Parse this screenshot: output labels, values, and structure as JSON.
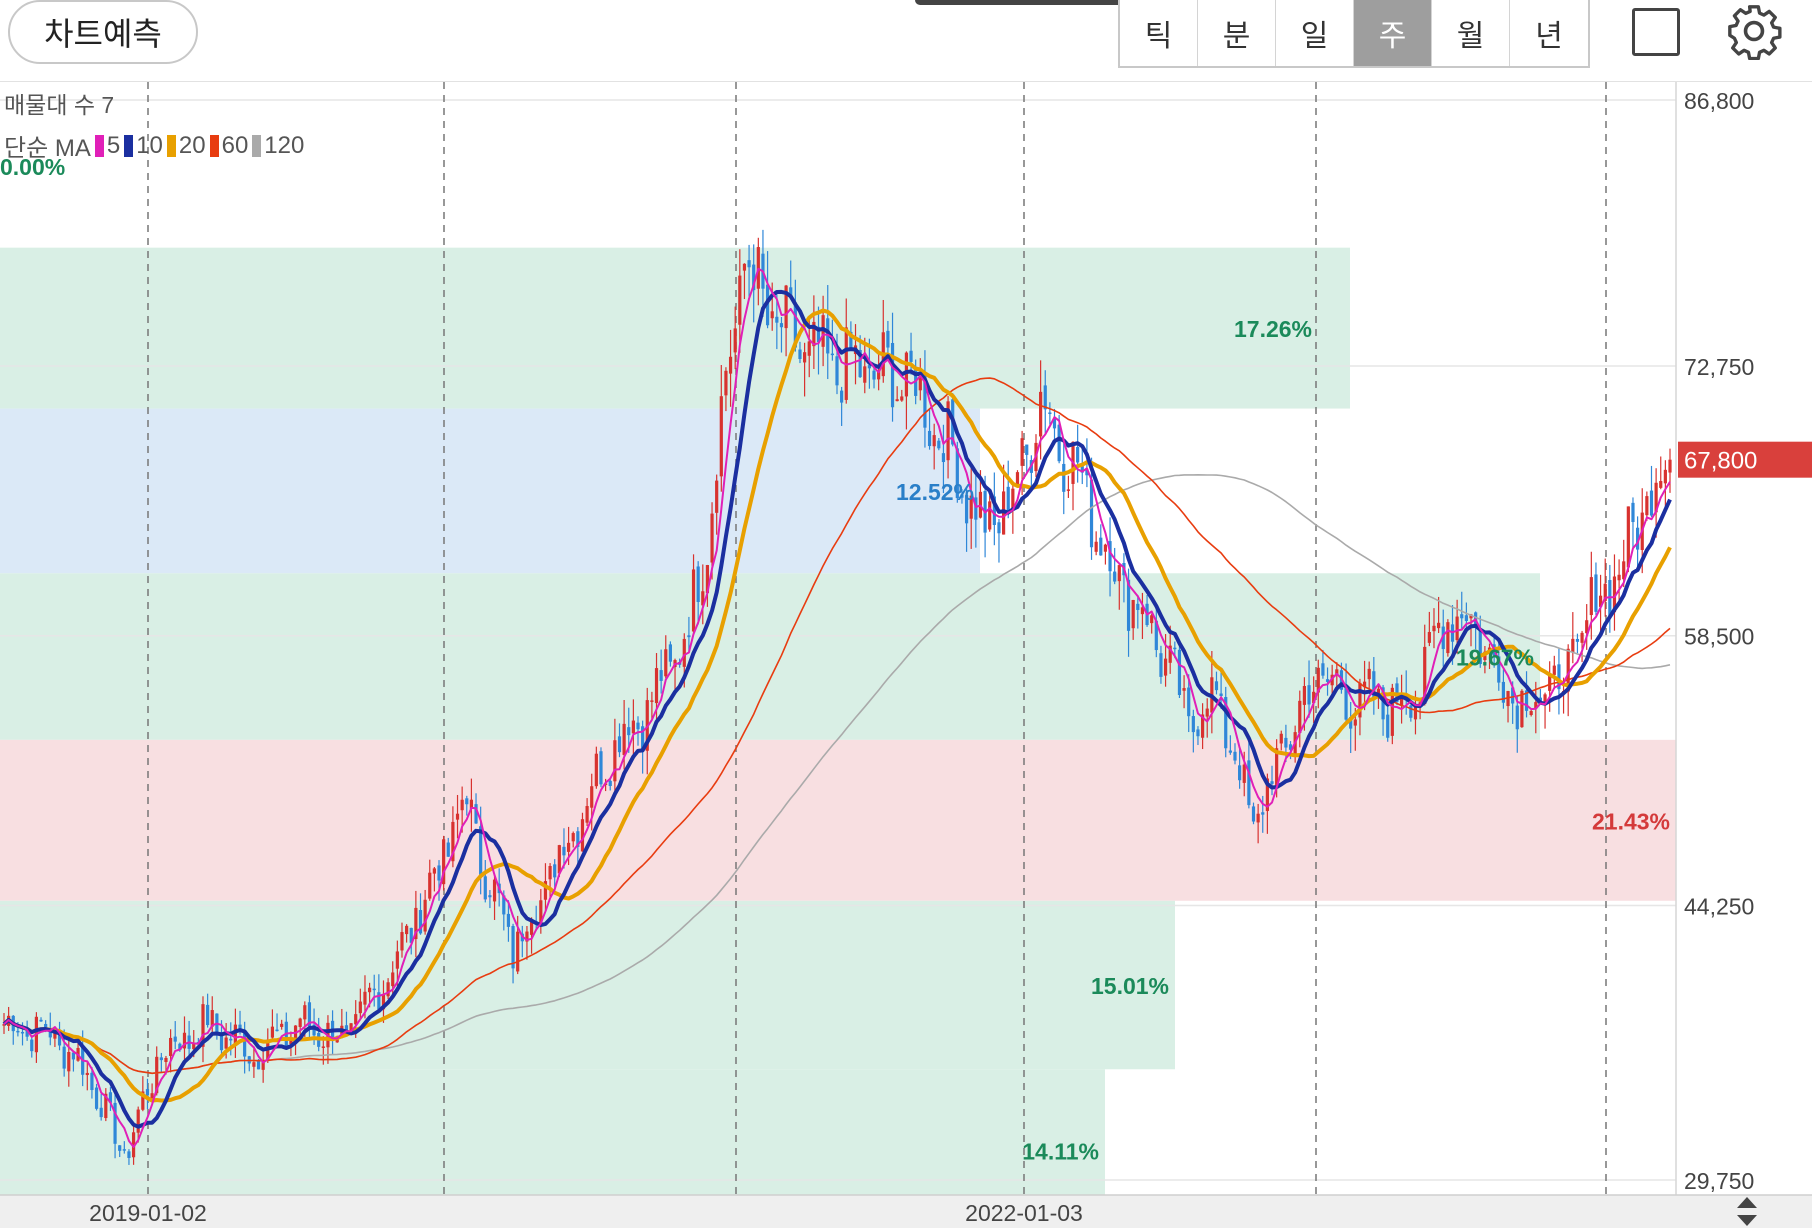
{
  "header": {
    "predict_button": "차트예측",
    "periods": [
      "틱",
      "분",
      "일",
      "주",
      "월",
      "년"
    ],
    "active_period": "주"
  },
  "indicators": {
    "volume_profile_label": "매물대 수 7",
    "ma_label": "단순 MA",
    "ma_lines": [
      {
        "period": "5",
        "color": "#e020b8"
      },
      {
        "period": "10",
        "color": "#1b2fa0"
      },
      {
        "period": "20",
        "color": "#e8a000"
      },
      {
        "period": "60",
        "color": "#e83c10"
      },
      {
        "period": "120",
        "color": "#aaaaaa"
      }
    ],
    "top_percent": "0.00%"
  },
  "price_axis": {
    "ticks": [
      "86,800",
      "72,750",
      "58,500",
      "44,250",
      "29,750"
    ],
    "current_price": "67,800"
  },
  "date_axis": {
    "labels": [
      "2019-01-02",
      "2022-01-03"
    ]
  },
  "chart_data": {
    "type": "candlestick",
    "interval": "weekly",
    "y_range": [
      29750,
      86800
    ],
    "current_price": 67800,
    "volume_profile": [
      {
        "low": 70500,
        "high": 79000,
        "percent": "17.26%",
        "color": "#d9efe5",
        "text_color": "#1b8a5a"
      },
      {
        "low": 61800,
        "high": 70500,
        "percent": "12.52%",
        "color": "#dbe9f7",
        "text_color": "#2a7fc8"
      },
      {
        "low": 53000,
        "high": 61800,
        "percent": "19.67%",
        "color": "#d9efe5",
        "text_color": "#1b8a5a"
      },
      {
        "low": 44500,
        "high": 53000,
        "percent": "21.43%",
        "color": "#f8dfe1",
        "text_color": "#d43a3a"
      },
      {
        "low": 35600,
        "high": 44500,
        "percent": "15.01%",
        "color": "#d9efe5",
        "text_color": "#1b8a5a"
      },
      {
        "low": 27000,
        "high": 35600,
        "percent": "14.11%",
        "color": "#d9efe5",
        "text_color": "#1b8a5a"
      }
    ],
    "close_trend": [
      [
        0,
        38000
      ],
      [
        10,
        37500
      ],
      [
        18,
        35500
      ],
      [
        26,
        31000
      ],
      [
        34,
        36500
      ],
      [
        44,
        38000
      ],
      [
        54,
        36500
      ],
      [
        64,
        38000
      ],
      [
        74,
        37200
      ],
      [
        86,
        42000
      ],
      [
        96,
        47500
      ],
      [
        100,
        50000
      ],
      [
        104,
        46000
      ],
      [
        110,
        42000
      ],
      [
        116,
        44800
      ],
      [
        122,
        48000
      ],
      [
        132,
        53000
      ],
      [
        140,
        55000
      ],
      [
        148,
        59000
      ],
      [
        152,
        64000
      ],
      [
        156,
        72000
      ],
      [
        160,
        78500
      ],
      [
        166,
        75000
      ],
      [
        176,
        73000
      ],
      [
        186,
        72500
      ],
      [
        196,
        72000
      ],
      [
        204,
        68500
      ],
      [
        212,
        64000
      ],
      [
        218,
        66000
      ],
      [
        224,
        71000
      ],
      [
        232,
        67000
      ],
      [
        240,
        62000
      ],
      [
        248,
        59000
      ],
      [
        256,
        54000
      ],
      [
        262,
        55500
      ],
      [
        270,
        48500
      ],
      [
        278,
        53500
      ],
      [
        284,
        56500
      ],
      [
        292,
        55000
      ],
      [
        300,
        54800
      ],
      [
        306,
        56000
      ],
      [
        312,
        60000
      ],
      [
        318,
        59000
      ],
      [
        324,
        56000
      ],
      [
        330,
        55000
      ],
      [
        338,
        56500
      ],
      [
        344,
        60500
      ],
      [
        350,
        62500
      ],
      [
        356,
        66500
      ],
      [
        360,
        67800
      ]
    ]
  }
}
